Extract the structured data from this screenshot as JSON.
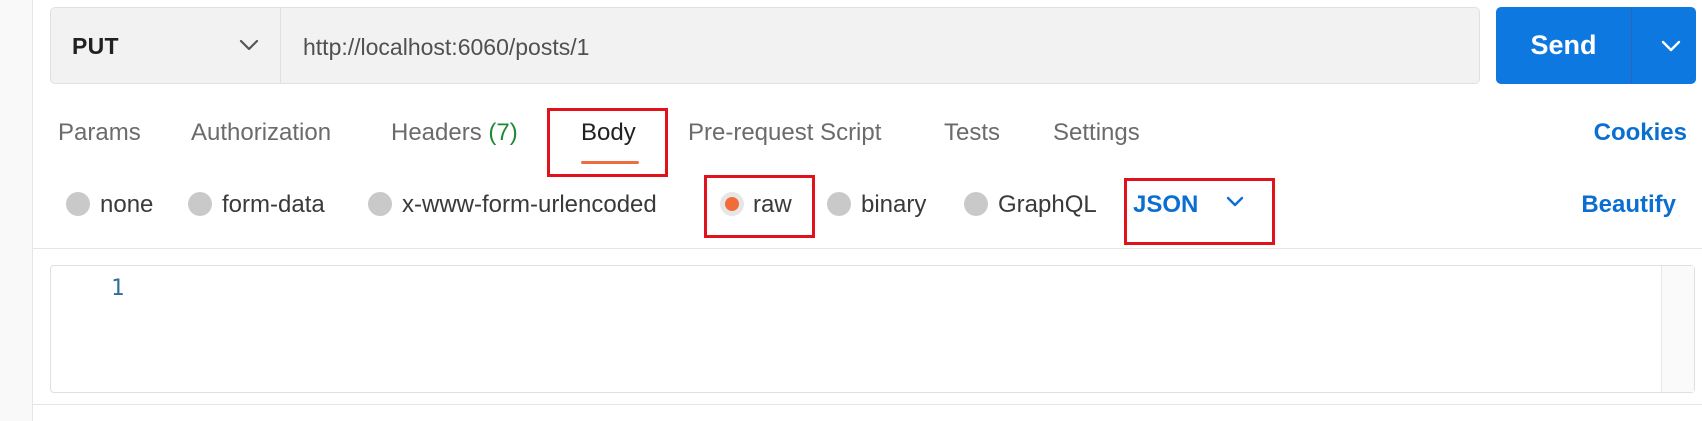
{
  "request": {
    "method": "PUT",
    "url": "http://localhost:6060/posts/1",
    "send_label": "Send"
  },
  "tabs": {
    "params": "Params",
    "authorization": "Authorization",
    "headers": "Headers",
    "headers_count": "(7)",
    "body": "Body",
    "prerequest": "Pre-request Script",
    "tests": "Tests",
    "settings": "Settings",
    "active": "Body"
  },
  "cookies_label": "Cookies",
  "body_types": {
    "none": "none",
    "form_data": "form-data",
    "urlencoded": "x-www-form-urlencoded",
    "raw": "raw",
    "binary": "binary",
    "graphql": "GraphQL",
    "selected": "raw"
  },
  "format": "JSON",
  "beautify_label": "Beautify",
  "editor": {
    "line_numbers": [
      "1"
    ]
  },
  "colors": {
    "send_bg": "#0c78e0",
    "link": "#0b6fd1",
    "accent_orange": "#ef6c40",
    "highlight_red": "#e0121b",
    "headers_count": "#1f8a37"
  }
}
